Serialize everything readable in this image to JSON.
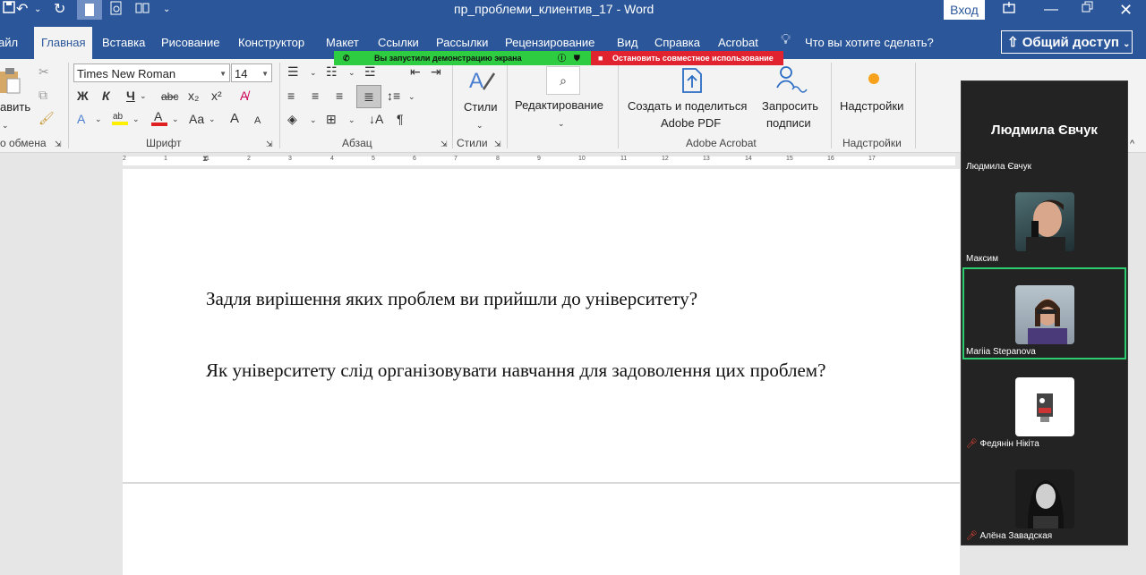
{
  "window": {
    "title": "пр_проблеми_клиентив_17  -  Word",
    "login": "Вход"
  },
  "tabs": [
    {
      "label": "айл"
    },
    {
      "label": "Главная"
    },
    {
      "label": "Вставка"
    },
    {
      "label": "Рисование"
    },
    {
      "label": "Конструктор"
    },
    {
      "label": "Макет"
    },
    {
      "label": "Ссылки"
    },
    {
      "label": "Рассылки"
    },
    {
      "label": "Рецензирование"
    },
    {
      "label": "Вид"
    },
    {
      "label": "Справка"
    },
    {
      "label": "Acrobat"
    }
  ],
  "tell_me": "Что вы хотите сделать?",
  "share_button": "Общий доступ",
  "screen_share": {
    "status": "Вы запустили демонстрацию экрана",
    "stop": "Остановить совместное использование"
  },
  "ribbon": {
    "paste_label": "авить",
    "clipboard_label": "о обмена",
    "font_name": "Times New Roman",
    "font_size": "14",
    "bold": "Ж",
    "italic": "К",
    "underline": "Ч",
    "strike": "abc",
    "subscript": "x₂",
    "superscript": "x²",
    "change_case": "Aa",
    "grow_font": "A",
    "shrink_font": "A",
    "font_group": "Шрифт",
    "paragraph_group": "Абзац",
    "styles_button": "Стили",
    "styles_group": "Стили",
    "editing_button": "Редактирование",
    "adobe_create": "Создать и поделиться",
    "adobe_pdf": "Adobe PDF",
    "request_sign_1": "Запросить",
    "request_sign_2": "подписи",
    "adobe_group": "Adobe Acrobat",
    "addins_button": "Надстройки",
    "addins_group": "Надстройки"
  },
  "ruler": {
    "numbers": [
      "2",
      "1",
      "1",
      "2",
      "3",
      "4",
      "5",
      "6",
      "7",
      "8",
      "9",
      "10",
      "11",
      "12",
      "13",
      "14",
      "15",
      "16",
      "17"
    ]
  },
  "document": {
    "paragraphs": [
      "Задля вирішення яких проблем ви прийшли до університету?",
      "Як університету слід організовувати навчання для задоволення цих проблем?"
    ]
  },
  "zoom_panel": {
    "speaker": "Людмила Євчук",
    "participants": [
      {
        "name": "Людмила Євчук"
      },
      {
        "name": "Максим"
      },
      {
        "name": "Mariia Stepanova"
      },
      {
        "name": "Федянін Нікіта"
      },
      {
        "name": "Алёна Завадская"
      }
    ]
  },
  "colors": {
    "word_blue": "#2b579a",
    "share_green": "#2ecc40",
    "stop_red": "#e0232e",
    "zoom_bg": "#232323",
    "active_speaker": "#2ecc71"
  }
}
